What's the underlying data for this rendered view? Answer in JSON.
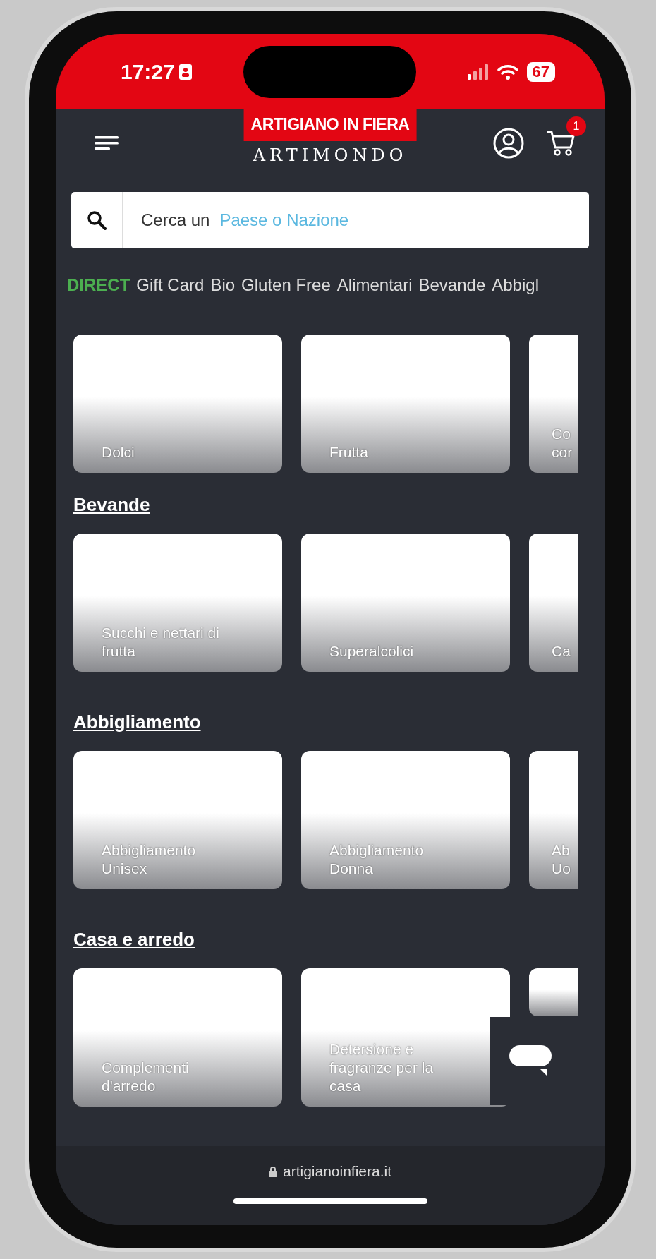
{
  "status_bar": {
    "time": "17:27",
    "battery": "67"
  },
  "header": {
    "brand_top": "ARTIGIANO IN FIERA",
    "brand_bottom": "ARTIMONDO",
    "cart_count": "1"
  },
  "search": {
    "prefix": "Cerca un",
    "placeholder": "Paese o Nazione"
  },
  "category_tabs": [
    {
      "label": "DIRECT",
      "kind": "highlight"
    },
    {
      "label": "Gift Card",
      "kind": "plain"
    },
    {
      "label": "Bio",
      "kind": "plain"
    },
    {
      "label": "Gluten Free",
      "kind": "plain"
    },
    {
      "label": "Alimentari",
      "kind": "plain"
    },
    {
      "label": "Bevande",
      "kind": "plain"
    },
    {
      "label": "Abbigl",
      "kind": "plain"
    }
  ],
  "sections": [
    {
      "cards": [
        {
          "kind": "full",
          "lines": [
            "Dolci"
          ]
        },
        {
          "kind": "full",
          "lines": [
            "Frutta"
          ]
        },
        {
          "kind": "partial",
          "lines": [
            "Co",
            "cor"
          ]
        }
      ]
    },
    {
      "heading": "Bevande",
      "cards": [
        {
          "kind": "full",
          "lines": [
            "Succhi e nettari di",
            "frutta"
          ]
        },
        {
          "kind": "full",
          "lines": [
            "Superalcolici"
          ]
        },
        {
          "kind": "partial",
          "lines": [
            "Ca"
          ]
        }
      ]
    },
    {
      "heading": "Abbigliamento",
      "cards": [
        {
          "kind": "full",
          "lines": [
            "Abbigliamento",
            "Unisex"
          ]
        },
        {
          "kind": "full",
          "lines": [
            "Abbigliamento",
            "Donna"
          ]
        },
        {
          "kind": "partial",
          "lines": [
            "Ab",
            "Uo"
          ]
        }
      ]
    },
    {
      "heading": "Casa e arredo",
      "cards": [
        {
          "kind": "full",
          "lines": [
            "Complementi",
            "d'arredo"
          ]
        },
        {
          "kind": "full",
          "lines": [
            "Detersione e",
            "fragranze per la",
            "casa"
          ]
        },
        {
          "kind": "covered"
        }
      ]
    }
  ],
  "browser_bar": {
    "url": "artigianoinfiera.it"
  }
}
